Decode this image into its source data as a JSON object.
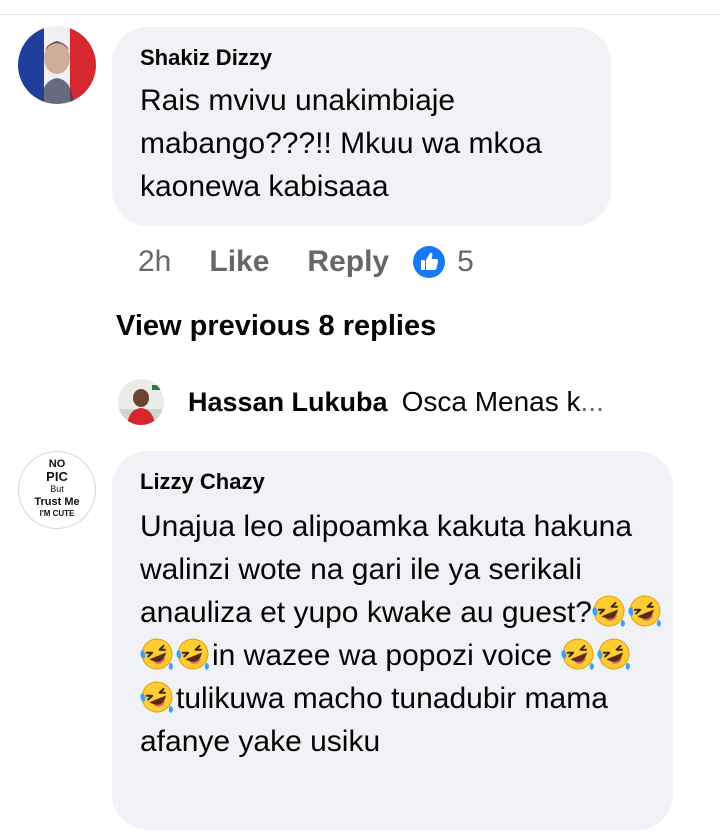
{
  "comments": [
    {
      "author": "Shakiz Dizzy",
      "text": "Rais mvivu unakimbiaje mabango???!! Mkuu wa mkoa kaonewa  kabisaaa",
      "time": "2h",
      "like_label": "Like",
      "reply_label": "Reply",
      "reaction_count": "5",
      "reaction_icon": "thumbs-up-icon",
      "avatar": "profile-photo-french-flag"
    },
    {
      "author": "Lizzy Chazy",
      "avatar": "no-pic-badge",
      "avatar_text": [
        "NO",
        "PIC",
        "But",
        "Trust Me",
        "I'M CUTE"
      ],
      "text_segments": [
        "Unajua leo alipoamka kakuta hakuna walinzi wote na gari ile ya serikali anauliza et yupo kwake au guest?",
        "in wazee wa popozi voice ",
        "tulikuwa macho tunadubir mama afanye yake usiku"
      ],
      "emoji": "rolling-on-floor-laughing-emoji"
    }
  ],
  "view_previous_label": "View previous 8 replies",
  "reply_preview": {
    "author": "Hassan Lukuba",
    "text": "Osca Menas k",
    "ellipsis": "..."
  },
  "colors": {
    "bubble": "#f0f2f5",
    "secondary_text": "#65676b",
    "like_blue": "#1877f2"
  }
}
